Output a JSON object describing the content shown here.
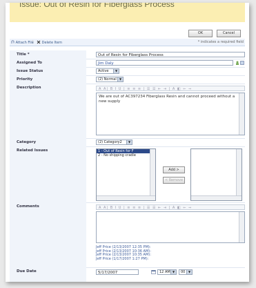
{
  "title": "Issue: Out of Resin for Fiberglass Process",
  "buttons": {
    "ok": "OK",
    "cancel": "Cancel",
    "add": "Add >",
    "remove": "< Remove"
  },
  "toolbar": {
    "attach": "Attach File",
    "delete": "Delete Item",
    "required_note": "* indicates a required field"
  },
  "labels": {
    "title": "Title *",
    "assigned_to": "Assigned To",
    "status": "Issue Status",
    "priority": "Priority",
    "description": "Description",
    "category": "Category",
    "related": "Related Issues",
    "comments": "Comments",
    "due_date": "Due Date"
  },
  "values": {
    "title": "Out of Resin for Fiberglass Process",
    "assigned_to": "Jim Daly",
    "status": "Active",
    "priority": "(2) Normal",
    "description": "We are out of AC397234 Fiberglass Resin and cannot proceed without a new supply",
    "category": "(2) Category2",
    "related_items": [
      "1 - Out of Resin for F",
      "2 - No shipping cradle"
    ],
    "due_date": "5/17/2007",
    "due_hour": "12 AM",
    "due_min": "00"
  },
  "rich_text_toolbar": "A A| B I U | ≡ ≡ ≡ | ☰ ☰ ⇤ ⇥ | A ◧ ⇐ ⇒",
  "history": [
    "Jeff Price   (2/13/2007 12:35 PM):",
    "Jeff Price   (2/13/2007 10:36 AM):",
    "Jeff Price   (2/13/2007 10:35 AM):",
    "Jeff Price   (1/17/2007 1:27 PM):"
  ],
  "colors": {
    "title_bg": "#fbeeb2",
    "label_bg": "#f0f4fa",
    "selected_item": "#2d4a8a"
  },
  "icons": {
    "attach": "paperclip-icon",
    "delete": "x-delete-icon",
    "people": "people-picker-icon",
    "address_book": "address-book-icon",
    "calendar": "calendar-icon"
  }
}
